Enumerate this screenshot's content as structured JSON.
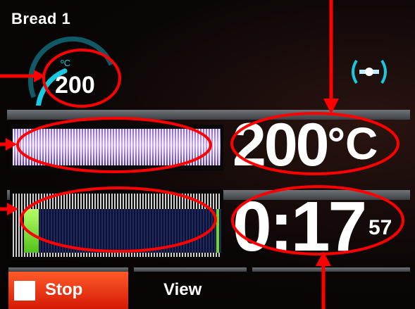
{
  "program": {
    "name": "Bread 1"
  },
  "gauge": {
    "unit": "ºC",
    "value": "200",
    "level": 0.55
  },
  "temperature": {
    "value": "200",
    "unit": "°C",
    "bar_level": 1.0
  },
  "timer": {
    "minutes_display": "0:17",
    "seconds": "57",
    "bar_level": 0.08
  },
  "buttons": {
    "stop": "Stop",
    "view": "View"
  },
  "icons": {
    "fan": "fan-icon",
    "stop": "stop-square-icon"
  },
  "colors": {
    "accent_cyan": "#19c9e0",
    "stop_red": "#e0330f",
    "annotation_red": "#ff0000",
    "temp_bar": "#b58fe6",
    "time_bar": "#7fe03a"
  }
}
